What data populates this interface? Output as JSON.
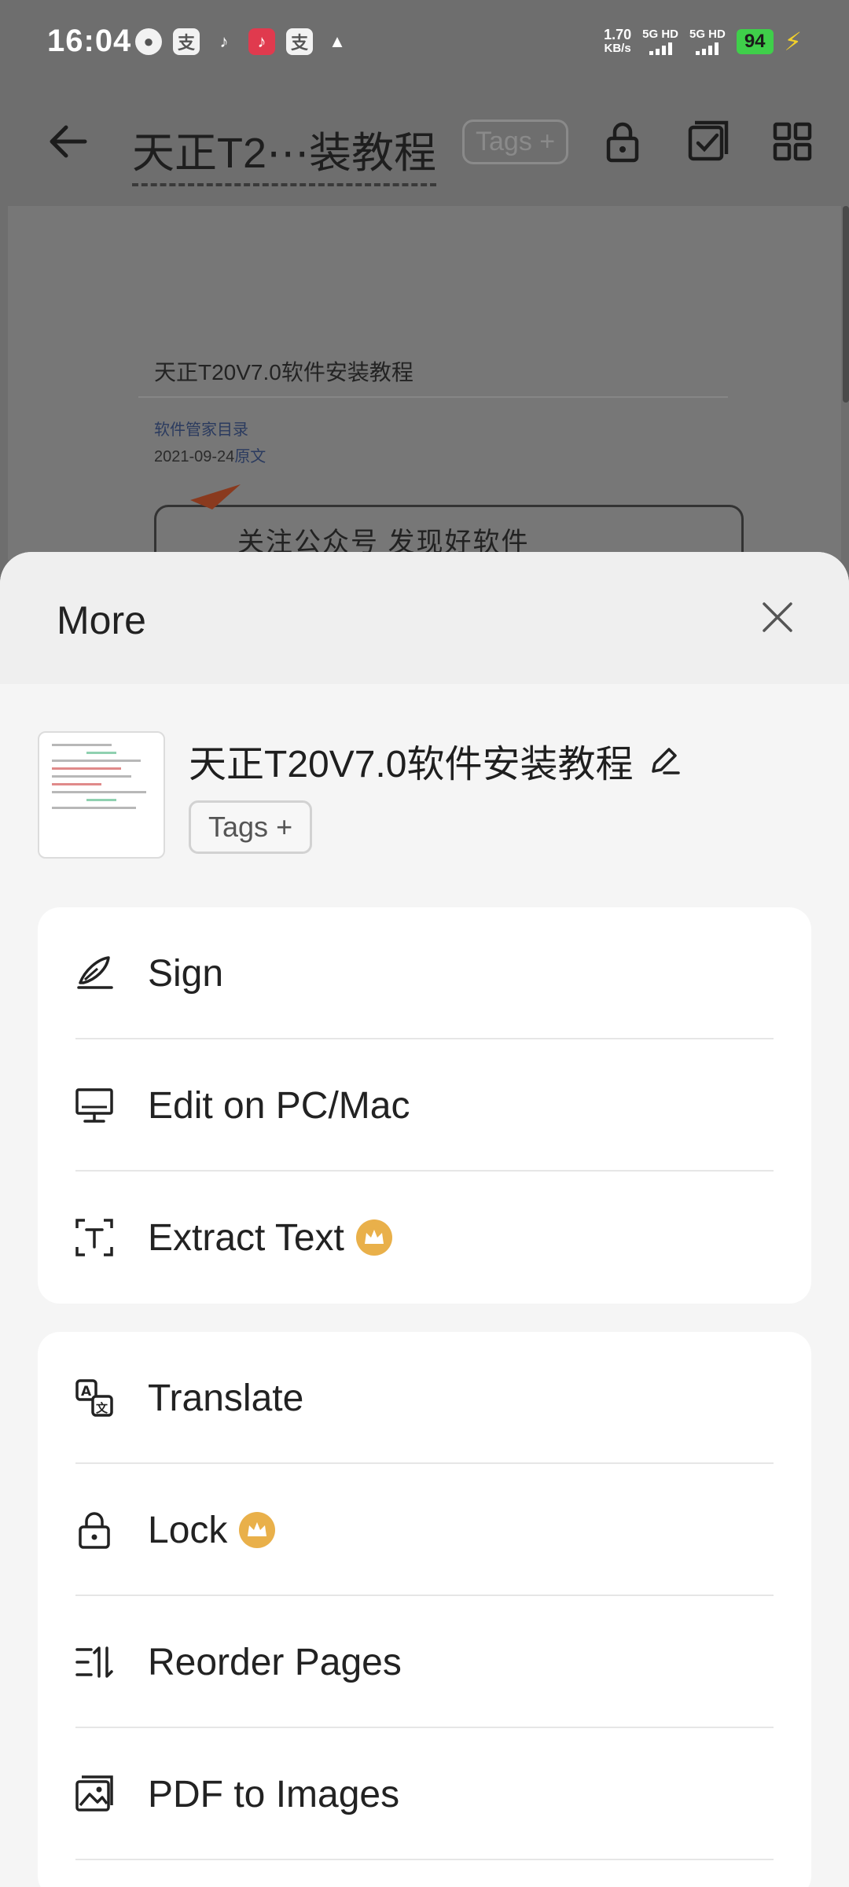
{
  "status_bar": {
    "time": "16:04",
    "notifications": [
      "message-icon",
      "alipay-icon",
      "tiktok-icon",
      "tiktok-lite-icon",
      "alipay-icon",
      "qq-icon"
    ],
    "net_speed_value": "1.70",
    "net_speed_unit": "KB/s",
    "signal_1": "5G HD",
    "signal_2": "5G HD",
    "battery": "94",
    "colors": {
      "battery": "#3fcf4a",
      "charging": "#f2d02a"
    }
  },
  "appbar": {
    "title": "天正T2⋯装教程",
    "tags_label": "Tags",
    "tags_plus": "+"
  },
  "doc_preview": {
    "title": "天正T20V7.0软件安装教程",
    "link": "软件管家目录",
    "date": "2021-09-24",
    "date_link": "原文",
    "banner": "关注公众号   发现好软件"
  },
  "sheet": {
    "title": "More",
    "file_name": "天正T20V7.0软件安装教程",
    "tags_label": "Tags",
    "tags_plus": "+",
    "group1": [
      {
        "label": "Sign",
        "icon": "signature-pen-icon",
        "premium": false
      },
      {
        "label": "Edit on PC/Mac",
        "icon": "desktop-monitor-icon",
        "premium": false
      },
      {
        "label": "Extract Text",
        "icon": "text-scan-icon",
        "premium": true
      }
    ],
    "group2": [
      {
        "label": "Translate",
        "icon": "translate-icon",
        "premium": false
      },
      {
        "label": "Lock",
        "icon": "lock-icon",
        "premium": true
      },
      {
        "label": "Reorder Pages",
        "icon": "reorder-icon",
        "premium": false
      },
      {
        "label": "PDF to Images",
        "icon": "image-icon",
        "premium": false
      }
    ],
    "colors": {
      "premium_crown": "#e9b04a"
    }
  }
}
